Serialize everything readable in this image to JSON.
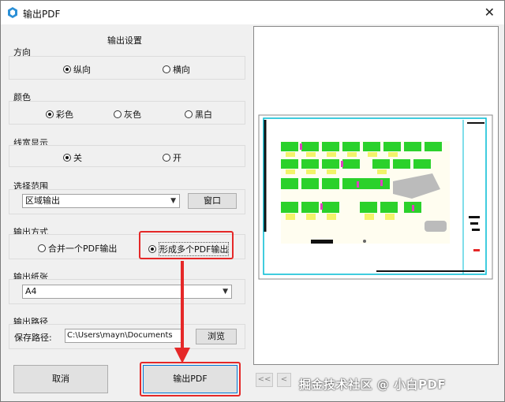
{
  "window": {
    "title": "输出PDF",
    "close_label": "✕",
    "app_icon": "app-logo-icon"
  },
  "settings": {
    "heading": "输出设置",
    "orientation": {
      "label": "方向",
      "options": [
        "纵向",
        "横向"
      ],
      "selected": "纵向"
    },
    "color": {
      "label": "颜色",
      "options": [
        "彩色",
        "灰色",
        "黑白"
      ],
      "selected": "彩色"
    },
    "lineweight": {
      "label": "线宽显示",
      "options": [
        "关",
        "开"
      ],
      "selected": "关"
    },
    "range": {
      "label": "选择范围",
      "value": "区域输出",
      "window_button": "窗口"
    },
    "output_mode": {
      "label": "输出方式",
      "options": [
        "合并一个PDF输出",
        "形成多个PDF输出"
      ],
      "selected": "形成多个PDF输出"
    },
    "paper": {
      "label": "输出纸张",
      "value": "A4"
    },
    "path": {
      "label": "输出路径",
      "field_label": "保存路径:",
      "value": "C:\\Users\\mayn\\Documents",
      "browse_button": "浏览"
    }
  },
  "buttons": {
    "cancel": "取消",
    "export": "输出PDF"
  },
  "nav": {
    "first": "<<",
    "prev": "<"
  },
  "watermark": "掘金技术社区 @ 小白PDF",
  "colors": {
    "highlight": "#e52828",
    "accent": "#00bcd4"
  }
}
